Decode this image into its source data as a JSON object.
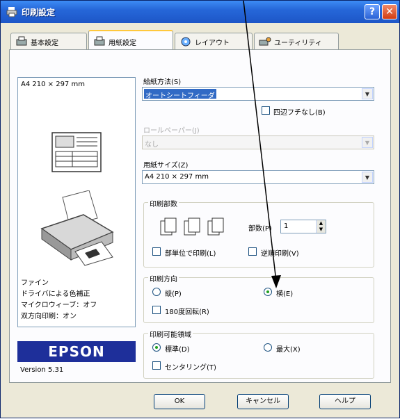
{
  "window": {
    "title": "印刷設定"
  },
  "title_buttons": {
    "help": "?",
    "close": "✕"
  },
  "tabs": [
    {
      "label": "基本設定",
      "icon": "basic-settings-icon"
    },
    {
      "label": "用紙設定",
      "icon": "paper-settings-icon",
      "active": true
    },
    {
      "label": "レイアウト",
      "icon": "layout-icon"
    },
    {
      "label": "ユーティリティ",
      "icon": "utility-icon"
    }
  ],
  "preview": {
    "paper_size": "A4 210 × 297 mm",
    "quality_lines": [
      "ファイン",
      "ドライバによる色補正",
      "マイクロウィーブ：オフ",
      "双方向印刷：オン"
    ]
  },
  "paper_source": {
    "label": "給紙方法(S)",
    "value": "オートシートフィーダ"
  },
  "borderless": {
    "label": "四辺フチなし(B)"
  },
  "roll_option": {
    "label": "ロールペーパー(J)",
    "value": "なし"
  },
  "paper_size": {
    "label": "用紙サイズ(Z)",
    "value": "A4 210 × 297 mm"
  },
  "copies_group": {
    "title": "印刷部数",
    "copies_label": "部数(P)",
    "copies_value": "1",
    "collate_label": "部単位で印刷(L)",
    "reverse_label": "逆順印刷(V)"
  },
  "orientation_group": {
    "title": "印刷方向",
    "portrait_label": "縦(P)",
    "landscape_label": "横(E)",
    "selected": "landscape",
    "rotate_label": "180度回転(R)"
  },
  "printable_area_group": {
    "title": "印刷可能領域",
    "standard_label": "標準(D)",
    "max_label": "最大(X)",
    "selected": "standard",
    "centering_label": "センタリング(T)"
  },
  "brand": {
    "logo": "EPSON",
    "version": "Version 5.31"
  },
  "buttons": {
    "ok": "OK",
    "cancel": "キャンセル",
    "help": "ヘルプ"
  },
  "colors": {
    "titlebar": "#2667d9",
    "selection": "#316ac5",
    "logo_bg": "#1e2f9a"
  }
}
